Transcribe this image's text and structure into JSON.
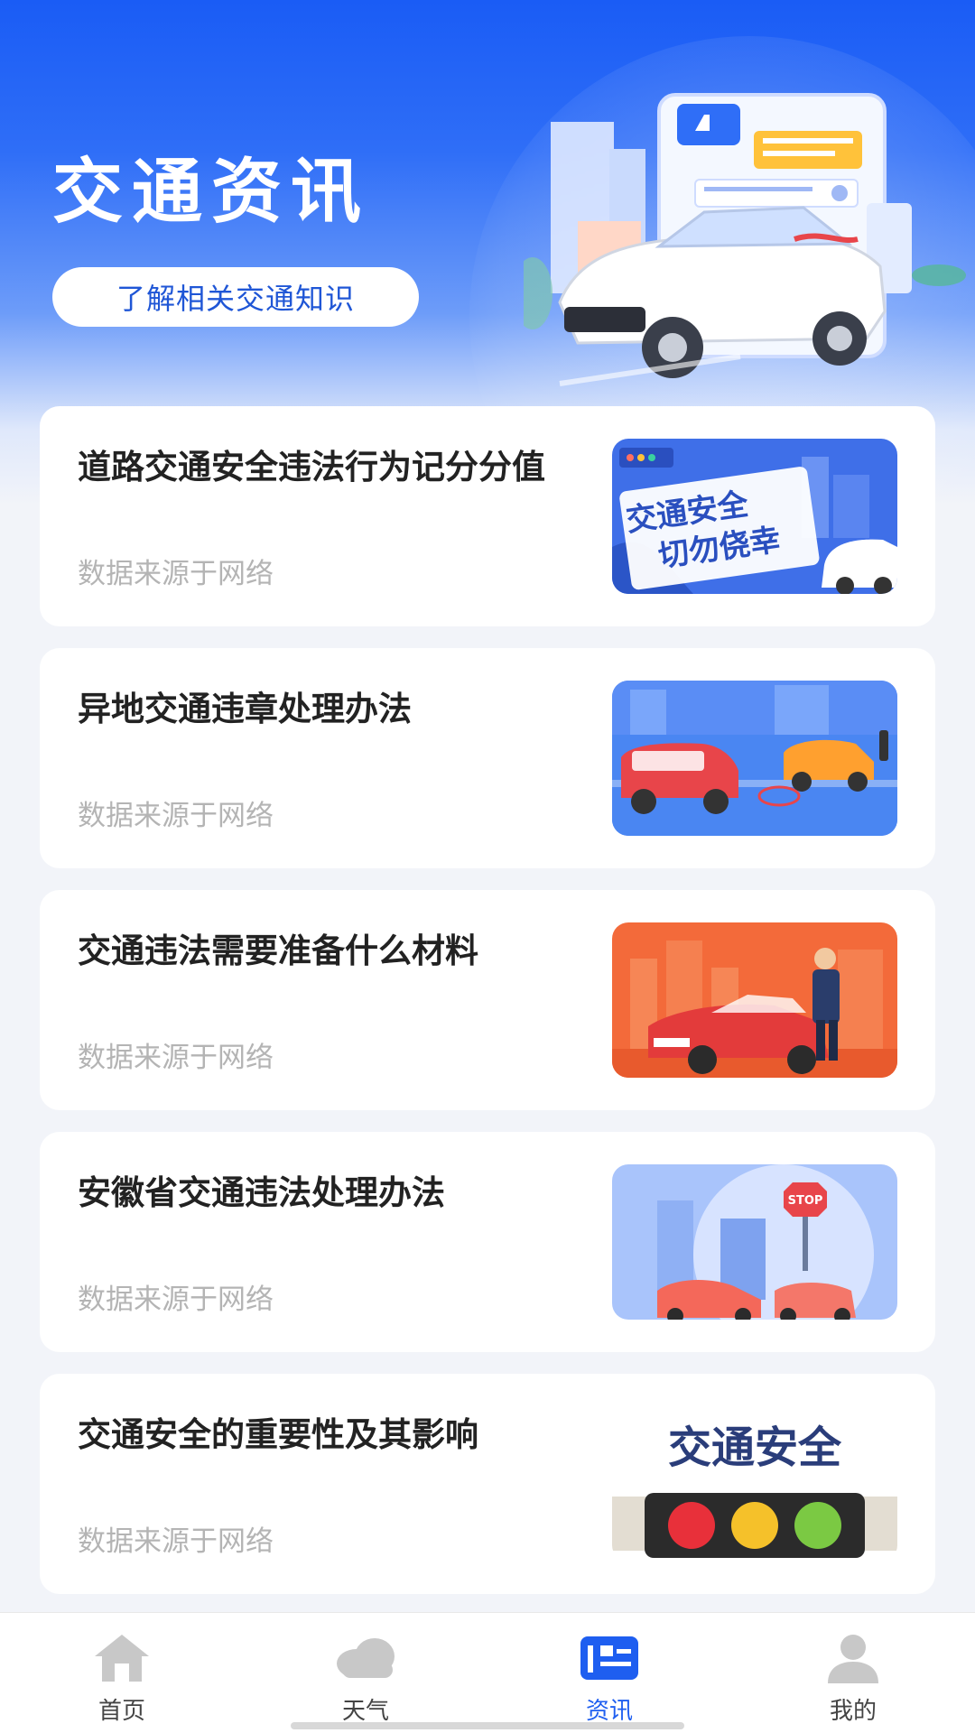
{
  "header": {
    "title": "交通资讯",
    "subtitle_button": "了解相关交通知识"
  },
  "news": [
    {
      "title": "道路交通安全违法行为记分分值",
      "source": "数据来源于网络",
      "thumb_text": [
        "交通安全",
        "切勿侥幸"
      ]
    },
    {
      "title": "异地交通违章处理办法",
      "source": "数据来源于网络"
    },
    {
      "title": "交通违法需要准备什么材料",
      "source": "数据来源于网络"
    },
    {
      "title": "安徽省交通违法处理办法",
      "source": "数据来源于网络",
      "thumb_text": [
        "STOP"
      ]
    },
    {
      "title": "交通安全的重要性及其影响",
      "source": "数据来源于网络",
      "thumb_text": [
        "交通安全"
      ]
    }
  ],
  "tabbar": {
    "items": [
      {
        "label": "首页",
        "icon": "home-icon",
        "active": false
      },
      {
        "label": "天气",
        "icon": "cloud-icon",
        "active": false
      },
      {
        "label": "资讯",
        "icon": "news-icon",
        "active": true
      },
      {
        "label": "我的",
        "icon": "user-icon",
        "active": false
      }
    ]
  },
  "colors": {
    "accent": "#1e5ef0",
    "header_blue": "#1a5cf5",
    "inactive_icon": "#c8c8c8",
    "source_text": "#b4b4b4"
  }
}
